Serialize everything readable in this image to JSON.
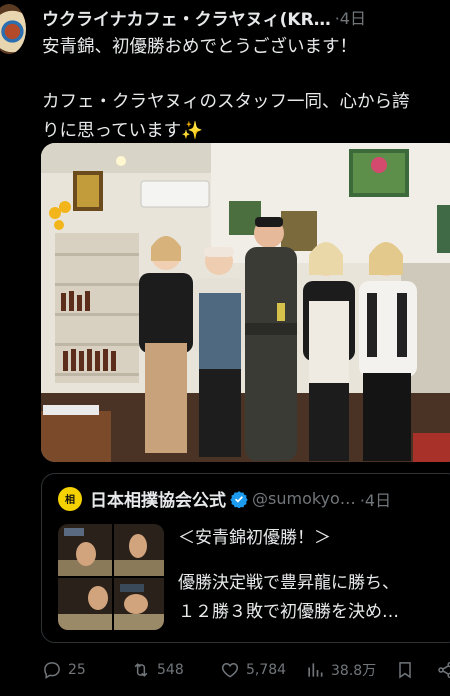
{
  "tweet": {
    "display_name": "ウクライナカフェ・クラヤヌィ(KR…",
    "time": "·4日",
    "line1": "安青錦、初優勝おめでとうございます！",
    "line2": "カフェ・クラヤヌィのスタッフ一同、心から誇",
    "line3": "りに思っています",
    "emoji": "✨"
  },
  "quote": {
    "logo_text": "相",
    "name": "日本相撲協会公式",
    "handle": "@sumokyo…",
    "time": "·4日",
    "line1": "＜安青錦初優勝！＞",
    "line2": "優勝決定戦で豊昇龍に勝ち、",
    "line3": "１２勝３敗で初優勝を決め…"
  },
  "actions": {
    "replies": "25",
    "retweets": "548",
    "likes": "5,784",
    "views": "38.8万"
  },
  "colors": {
    "background": "#000000",
    "text": "#e7e9ea",
    "secondary": "#71767b",
    "verified": "#1d9bf0"
  }
}
